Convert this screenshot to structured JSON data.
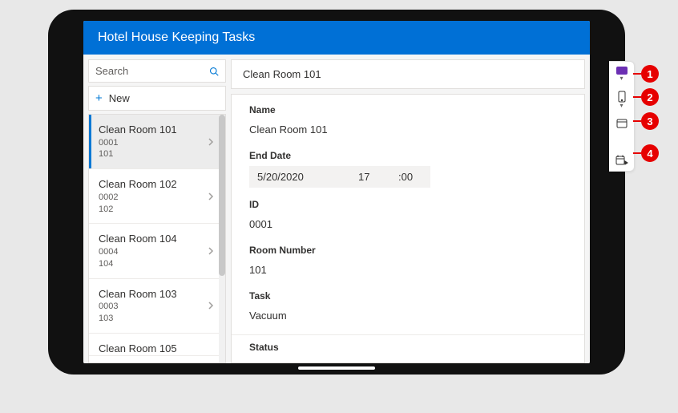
{
  "header": {
    "title": "Hotel House Keeping Tasks"
  },
  "search": {
    "placeholder": "Search"
  },
  "newButton": {
    "label": "New"
  },
  "list": {
    "items": [
      {
        "title": "Clean Room 101",
        "id": "0001",
        "room": "101",
        "selected": true
      },
      {
        "title": "Clean Room 102",
        "id": "0002",
        "room": "102",
        "selected": false
      },
      {
        "title": "Clean Room 104",
        "id": "0004",
        "room": "104",
        "selected": false
      },
      {
        "title": "Clean Room 103",
        "id": "0003",
        "room": "103",
        "selected": false
      },
      {
        "title": "Clean Room 105",
        "id": "",
        "room": "",
        "selected": false,
        "partial": true
      }
    ]
  },
  "detail": {
    "headerTitle": "Clean Room 101",
    "fields": {
      "name": {
        "label": "Name",
        "value": "Clean Room 101"
      },
      "endDate": {
        "label": "End Date",
        "date": "5/20/2020",
        "hour": "17",
        "minSep": ":00"
      },
      "id": {
        "label": "ID",
        "value": "0001"
      },
      "roomNumber": {
        "label": "Room Number",
        "value": "101"
      },
      "task": {
        "label": "Task",
        "value": "Vacuum"
      },
      "status": {
        "label": "Status",
        "value": ""
      }
    }
  },
  "callouts": [
    "1",
    "2",
    "3",
    "4"
  ]
}
